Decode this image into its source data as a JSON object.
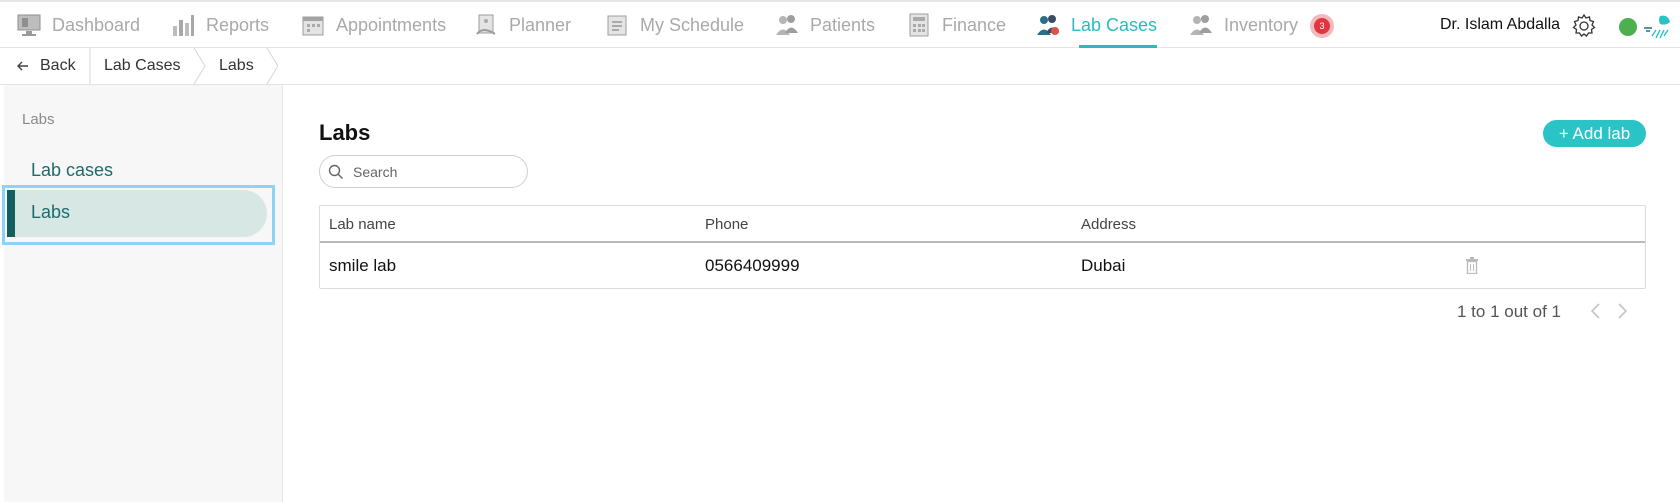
{
  "nav": {
    "items": [
      {
        "label": "Dashboard",
        "icon": "monitor-icon"
      },
      {
        "label": "Reports",
        "icon": "bar-chart-icon"
      },
      {
        "label": "Appointments",
        "icon": "calendar-icon"
      },
      {
        "label": "Planner",
        "icon": "planner-icon"
      },
      {
        "label": "My Schedule",
        "icon": "schedule-icon"
      },
      {
        "label": "Patients",
        "icon": "people-icon"
      },
      {
        "label": "Finance",
        "icon": "calculator-icon"
      },
      {
        "label": "Lab Cases",
        "icon": "lab-cases-icon"
      },
      {
        "label": "Inventory",
        "icon": "inventory-icon"
      }
    ],
    "active": "Lab Cases",
    "notification_count": "3",
    "user_name": "Dr. Islam Abdalla",
    "accent_color": "#2bbbbf",
    "status_color": "#4caf50"
  },
  "breadcrumb": {
    "back_label": "Back",
    "items": [
      "Lab Cases",
      "Labs"
    ]
  },
  "sidebar": {
    "heading": "Labs",
    "items": [
      {
        "label": "Lab cases"
      },
      {
        "label": "Labs"
      }
    ],
    "active": "Labs"
  },
  "main": {
    "title": "Labs",
    "add_button": "+ Add lab",
    "search_placeholder": "Search",
    "table": {
      "columns": [
        "Lab name",
        "Phone",
        "Address"
      ],
      "rows": [
        {
          "name": "smile lab",
          "phone": "0566409999",
          "address": "Dubai"
        }
      ]
    },
    "pagination": "1 to 1 out of 1"
  }
}
